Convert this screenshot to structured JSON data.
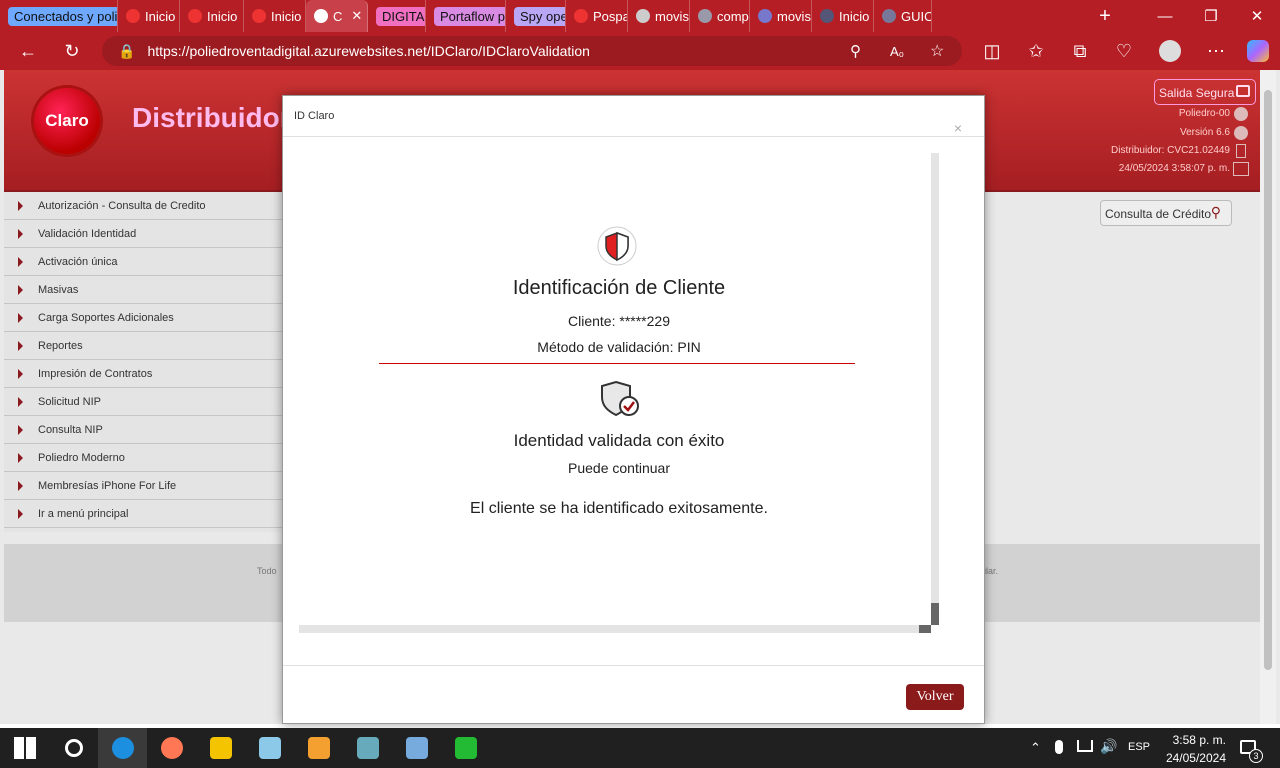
{
  "browser": {
    "tabs": [
      {
        "label": "Conectados y poli",
        "type": "group",
        "color": "#6ea8ff"
      },
      {
        "label": "Inicio",
        "type": "tab"
      },
      {
        "label": "Inicio",
        "type": "tab"
      },
      {
        "label": "Inicio",
        "type": "tab"
      },
      {
        "label": "C",
        "type": "active"
      },
      {
        "label": "DIGITAL",
        "type": "group",
        "color": "#f06fc0"
      },
      {
        "label": "Portaflow pajarito",
        "type": "group",
        "color": "#d98be3"
      },
      {
        "label": "Spy oper",
        "type": "group",
        "color": "#b9a7f5"
      },
      {
        "label": "Pospa",
        "type": "tab"
      },
      {
        "label": "movis",
        "type": "tab"
      },
      {
        "label": "compr",
        "type": "tab"
      },
      {
        "label": "movis",
        "type": "tab"
      },
      {
        "label": "Inicio",
        "type": "tab"
      },
      {
        "label": "GUIO",
        "type": "tab"
      }
    ],
    "url": "https://poliedroventadigital.azurewebsites.net/IDClaro/IDClaroValidation"
  },
  "site": {
    "logo_text": "Claro",
    "title": "Distribuidor",
    "salida": "Salida Segura",
    "info": [
      "Poliedro-00",
      "Versión 6.6",
      "Distribuidor: CVC21.02449",
      "24/05/2024 3:58:07 p. m."
    ],
    "consulta_credito": "Consulta de Crédito",
    "footer_left": "Todo",
    "footer_right": "titular.",
    "menu": [
      "Autorización - Consulta de Credito",
      "Validación Identidad",
      "Activación única",
      "Masivas",
      "Carga Soportes Adicionales",
      "Reportes",
      "Impresión de Contratos",
      "Solicitud NIP",
      "Consulta NIP",
      "Poliedro Moderno",
      "Membresías iPhone For Life",
      "Ir a menú principal"
    ]
  },
  "modal": {
    "title": "ID Claro",
    "close": "×",
    "heading": "Identificación de Cliente",
    "cliente": "Cliente: *****229",
    "metodo": "Método de validación: PIN",
    "success_title": "Identidad validada con éxito",
    "success_sub": "Puede continuar",
    "message": "El cliente se ha identificado exitosamente.",
    "volver": "Volver"
  },
  "taskbar": {
    "lang": "ESP",
    "time": "3:58 p. m.",
    "date": "24/05/2024",
    "notifications": "3",
    "apps": [
      "windows-start",
      "search",
      "edge",
      "firefox",
      "file-explorer",
      "notepad",
      "app-orange",
      "paint",
      "calculator",
      "spreadsheet"
    ]
  }
}
